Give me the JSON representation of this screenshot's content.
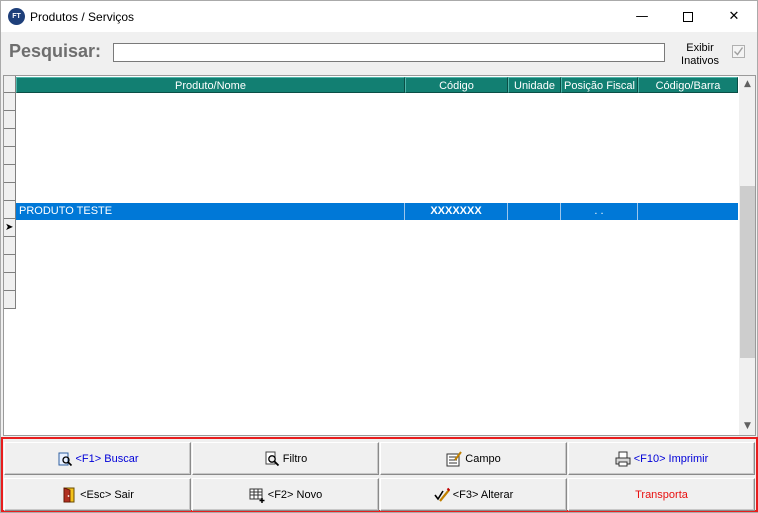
{
  "window": {
    "icon_text": "FT",
    "title": "Produtos / Serviços",
    "controls": {
      "minimize": "—",
      "close": "✕"
    }
  },
  "search": {
    "label": "Pesquisar:",
    "value": "",
    "show_inactive_label_line1": "Exibir",
    "show_inactive_label_line2": "Inativos",
    "show_inactive_checked": true
  },
  "grid": {
    "columns": [
      "Produto/Nome",
      "Código",
      "Unidade",
      "Posição Fiscal",
      "Código/Barra"
    ],
    "header_color": "#127f72",
    "selection_color": "#0078d7",
    "selected_row": {
      "indicator": "➤",
      "produto": "PRODUTO TESTE",
      "codigo": "XXXXXXX",
      "unidade": "",
      "posicao_fiscal": ". .",
      "codigo_barra": ""
    },
    "scroll_up": "▲",
    "scroll_down": "▼"
  },
  "buttons": {
    "row1": [
      {
        "label": "<F1> Buscar",
        "icon": "search-icon",
        "color": "#0000d8"
      },
      {
        "label": "Filtro",
        "icon": "filter-icon",
        "color": "#000000"
      },
      {
        "label": "Campo",
        "icon": "field-icon",
        "color": "#000000"
      },
      {
        "label": "<F10> Imprimir",
        "icon": "printer-icon",
        "color": "#0000d8"
      }
    ],
    "row2": [
      {
        "label": "<Esc> Sair",
        "icon": "exit-door-icon",
        "color": "#000000"
      },
      {
        "label": "<F2> Novo",
        "icon": "new-record-icon",
        "color": "#000000"
      },
      {
        "label": "<F3> Alterar",
        "icon": "edit-icon",
        "color": "#000000"
      },
      {
        "label": "Transporta",
        "icon": "",
        "color": "#e81010"
      }
    ]
  },
  "colors": {
    "highlight_border": "#e81d1d"
  }
}
